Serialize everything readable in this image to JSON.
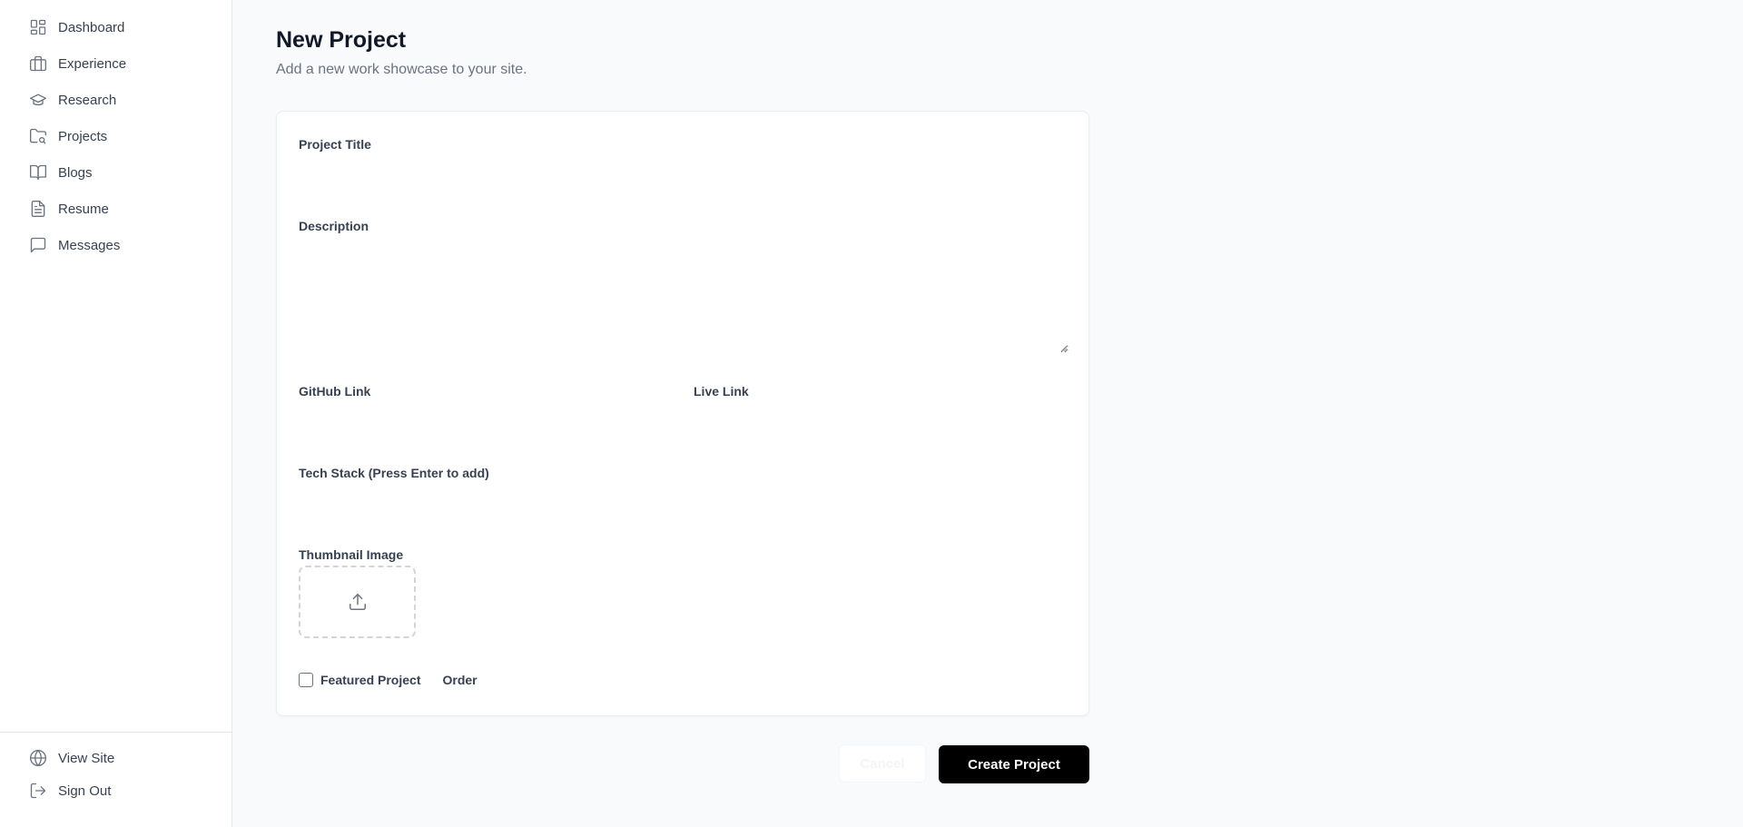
{
  "sidebar": {
    "items": [
      {
        "label": "Dashboard",
        "icon": "dashboard-icon"
      },
      {
        "label": "Experience",
        "icon": "briefcase-icon"
      },
      {
        "label": "Research",
        "icon": "graduation-cap-icon"
      },
      {
        "label": "Projects",
        "icon": "folder-search-icon"
      },
      {
        "label": "Blogs",
        "icon": "book-open-icon"
      },
      {
        "label": "Resume",
        "icon": "file-text-icon"
      },
      {
        "label": "Messages",
        "icon": "message-square-icon"
      }
    ],
    "bottom": [
      {
        "label": "View Site",
        "icon": "globe-icon"
      },
      {
        "label": "Sign Out",
        "icon": "log-out-icon"
      }
    ]
  },
  "header": {
    "title": "New Project",
    "subtitle": "Add a new work showcase to your site."
  },
  "form": {
    "title_label": "Project Title",
    "title_value": "",
    "description_label": "Description",
    "description_value": "",
    "github_label": "GitHub Link",
    "github_value": "",
    "live_label": "Live Link",
    "live_value": "",
    "tech_label": "Tech Stack (Press Enter to add)",
    "tech_value": "",
    "thumbnail_label": "Thumbnail Image",
    "upload_icon": "upload-icon",
    "featured_label": "Featured Project",
    "featured_checked": false,
    "order_label": "Order"
  },
  "actions": {
    "cancel_label": "Cancel",
    "create_label": "Create Project"
  },
  "colors": {
    "accent": "#000000",
    "sidebar_bg": "#ffffff",
    "page_bg": "#f9fafb",
    "text": "#111827",
    "muted": "#6b7280"
  }
}
